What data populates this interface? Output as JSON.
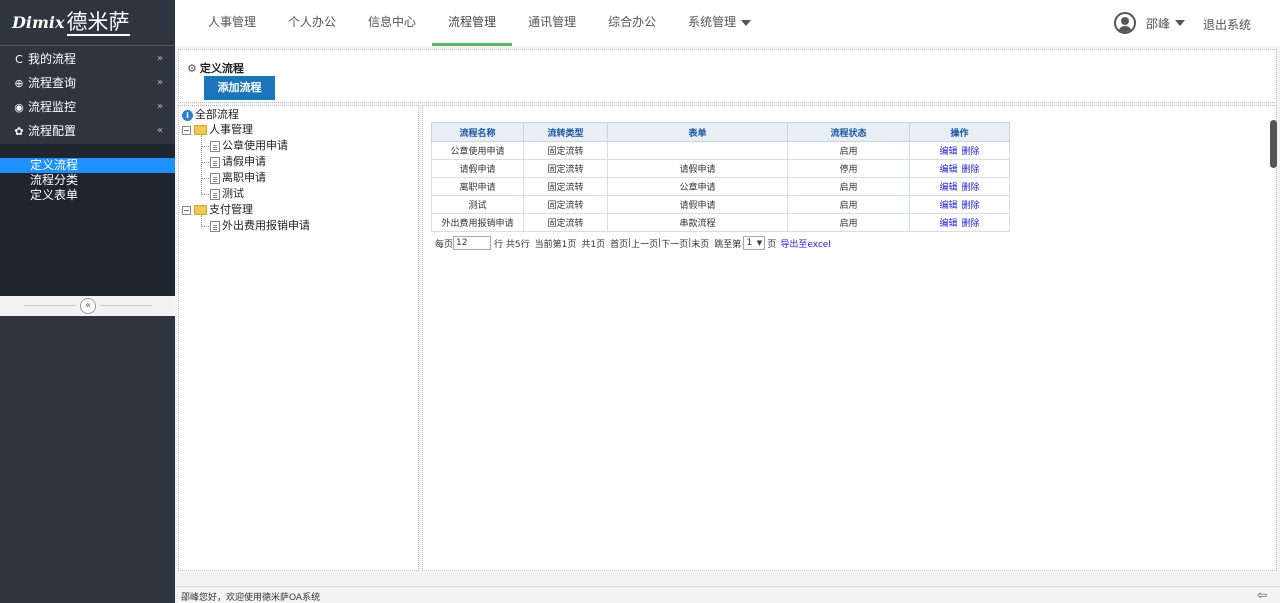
{
  "header": {
    "logo_brand": "Dimix",
    "logo_cn": "德米萨",
    "nav": [
      {
        "label": "人事管理",
        "active": false
      },
      {
        "label": "个人办公",
        "active": false
      },
      {
        "label": "信息中心",
        "active": false
      },
      {
        "label": "流程管理",
        "active": true
      },
      {
        "label": "通讯管理",
        "active": false
      },
      {
        "label": "综合办公",
        "active": false
      },
      {
        "label": "系统管理",
        "active": false,
        "dropdown": true
      }
    ],
    "user_name": "邵峰",
    "logout": "退出系统",
    "accent_color": "#5cb85c"
  },
  "sidebar": {
    "menu": [
      {
        "label": "我的流程",
        "icon": "refresh-icon",
        "glyph": "C",
        "arrow": "»"
      },
      {
        "label": "流程查询",
        "icon": "search-icon",
        "glyph": "⊕",
        "arrow": "»"
      },
      {
        "label": "流程监控",
        "icon": "eye-icon",
        "glyph": "◉",
        "arrow": "»"
      },
      {
        "label": "流程配置",
        "icon": "gear-icon",
        "glyph": "✿",
        "arrow": "«"
      }
    ],
    "submenu": [
      {
        "label": "定义流程",
        "active": true
      },
      {
        "label": "流程分类",
        "active": false
      },
      {
        "label": "定义表单",
        "active": false
      }
    ],
    "collapse_glyph": "«"
  },
  "toolbar": {
    "title": "定义流程",
    "add_button": "添加流程"
  },
  "tree": {
    "root": "全部流程",
    "groups": [
      {
        "label": "人事管理",
        "items": [
          "公章使用申请",
          "请假申请",
          "离职申请",
          "测试"
        ]
      },
      {
        "label": "支付管理",
        "items": [
          "外出费用报销申请"
        ]
      }
    ]
  },
  "table": {
    "headers": [
      "流程名称",
      "流转类型",
      "表单",
      "流程状态",
      "操作"
    ],
    "rows": [
      {
        "name": "公章使用申请",
        "type": "固定流转",
        "form": "",
        "status": "启用"
      },
      {
        "name": "请假申请",
        "type": "固定流转",
        "form": "请假申请",
        "status": "停用"
      },
      {
        "name": "离职申请",
        "type": "固定流转",
        "form": "公章申请",
        "status": "启用"
      },
      {
        "name": "测试",
        "type": "固定流转",
        "form": "请假申请",
        "status": "启用"
      },
      {
        "name": "外出费用报销申请",
        "type": "固定流转",
        "form": "串款流程",
        "status": "启用"
      }
    ],
    "edit_label": "编辑",
    "delete_label": "删除"
  },
  "pager": {
    "per_page_label": "每页",
    "per_page_value": "12",
    "total_text": "行 共5行",
    "current_text": "当前第1页",
    "pages_text": "共1页",
    "first": "首页",
    "prev": "上一页",
    "next": "下一页",
    "last": "末页",
    "jump_label": "跳至第",
    "page_value": "1",
    "page_suffix": "页",
    "export": "导出至excel"
  },
  "status": {
    "welcome": "邵峰您好，欢迎使用德米萨OA系统"
  }
}
